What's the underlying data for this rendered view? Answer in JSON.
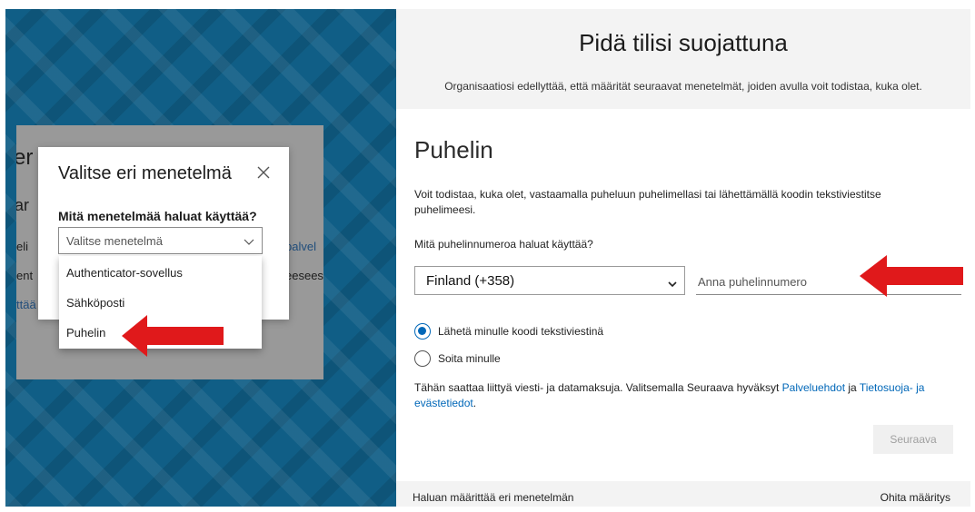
{
  "left_panel": {
    "background_text": {
      "heading_fragment": "er",
      "line2_fragment": "ar",
      "line3_left": "eli",
      "line3_right": "palvel",
      "line4_left": "ent",
      "line4_right": "eesees",
      "line5_left": "ttää"
    },
    "modal": {
      "title": "Valitse eri menetelmä",
      "question": "Mitä menetelmää haluat käyttää?",
      "select_placeholder": "Valitse menetelmä",
      "options": [
        {
          "label": "Authenticator-sovellus"
        },
        {
          "label": "Sähköposti"
        },
        {
          "label": "Puhelin"
        }
      ]
    }
  },
  "right_panel": {
    "title": "Pidä tilisi suojattuna",
    "subtitle": "Organisaatiosi edellyttää, että määrität seuraavat menetelmät, joiden avulla voit todistaa, kuka olet.",
    "section_title": "Puhelin",
    "description": "Voit todistaa, kuka olet, vastaamalla puheluun puhelimellasi tai lähettämällä koodin tekstiviestitse puhelimeesi.",
    "phone_question": "Mitä puhelinnumeroa haluat käyttää?",
    "country_value": "Finland (+358)",
    "phone_placeholder": "Anna puhelinnumero",
    "radio_options": [
      {
        "label": "Lähetä minulle koodi tekstiviestinä",
        "selected": true
      },
      {
        "label": "Soita minulle",
        "selected": false
      }
    ],
    "legal_prefix": "Tähän saattaa liittyä viesti- ja datamaksuja. Valitsemalla Seuraava hyväksyt ",
    "legal_link1": "Palveluehdot",
    "legal_mid": " ja ",
    "legal_link2": "Tietosuoja- ja evästetiedot",
    "legal_suffix": ".",
    "next_button": "Seuraava",
    "footer_left": "Haluan määrittää eri menetelmän",
    "footer_right": "Ohita määritys"
  },
  "colors": {
    "background": "#105e86",
    "accent": "#0067b8",
    "arrow": "#e0191b"
  },
  "icons": [
    "close-icon",
    "chevron-down-icon",
    "red-arrow-annotation"
  ]
}
